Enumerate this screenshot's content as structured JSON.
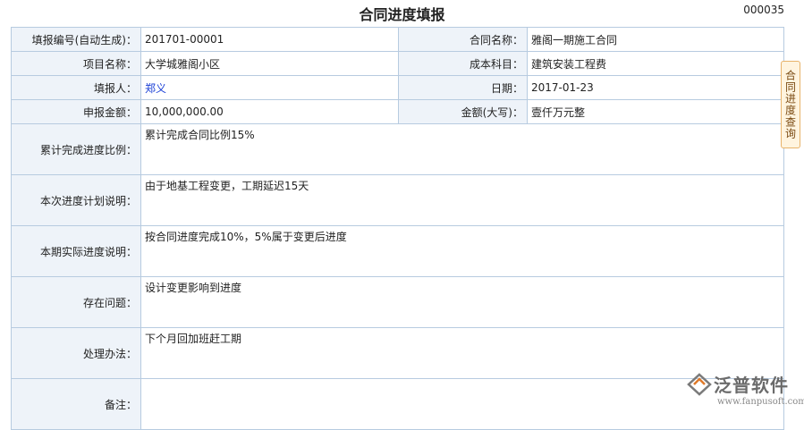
{
  "header": {
    "title": "合同进度填报",
    "doc_number": "000035"
  },
  "form": {
    "report_no": {
      "label": "填报编号(自动生成)：",
      "value": "201701-00001"
    },
    "contract": {
      "label": "合同名称：",
      "value": "雅阁一期施工合同"
    },
    "project": {
      "label": "项目名称：",
      "value": "大学城雅阁小区"
    },
    "cost_item": {
      "label": "成本科目：",
      "value": "建筑安装工程费"
    },
    "reporter": {
      "label": "填报人：",
      "value": "郑义"
    },
    "date": {
      "label": "日期：",
      "value": "2017-01-23"
    },
    "amount": {
      "label": "申报金额：",
      "value": "10,000,000.00"
    },
    "amount_cap": {
      "label": "金额(大写)：",
      "value": "壹仟万元整"
    },
    "cum_ratio": {
      "label": "累计完成进度比例：",
      "value": "累计完成合同比例15%"
    },
    "plan_note": {
      "label": "本次进度计划说明：",
      "value": "由于地基工程变更，工期延迟15天"
    },
    "actual_note": {
      "label": "本期实际进度说明：",
      "value": "按合同进度完成10%，5%属于变更后进度"
    },
    "issues": {
      "label": "存在问题：",
      "value": "设计变更影响到进度"
    },
    "solution": {
      "label": "处理办法：",
      "value": "下个月回加班赶工期"
    },
    "remarks": {
      "label": "备注：",
      "value": ""
    }
  },
  "side_tab": {
    "label": "合同进度查询"
  },
  "watermark": {
    "name": "泛普软件",
    "url": "www.fanpusoft.com"
  },
  "colors": {
    "border": "#b7cbe0",
    "label_bg": "#eef3f9",
    "link": "#1a3fd6",
    "tab_bg": "#fff4df"
  }
}
